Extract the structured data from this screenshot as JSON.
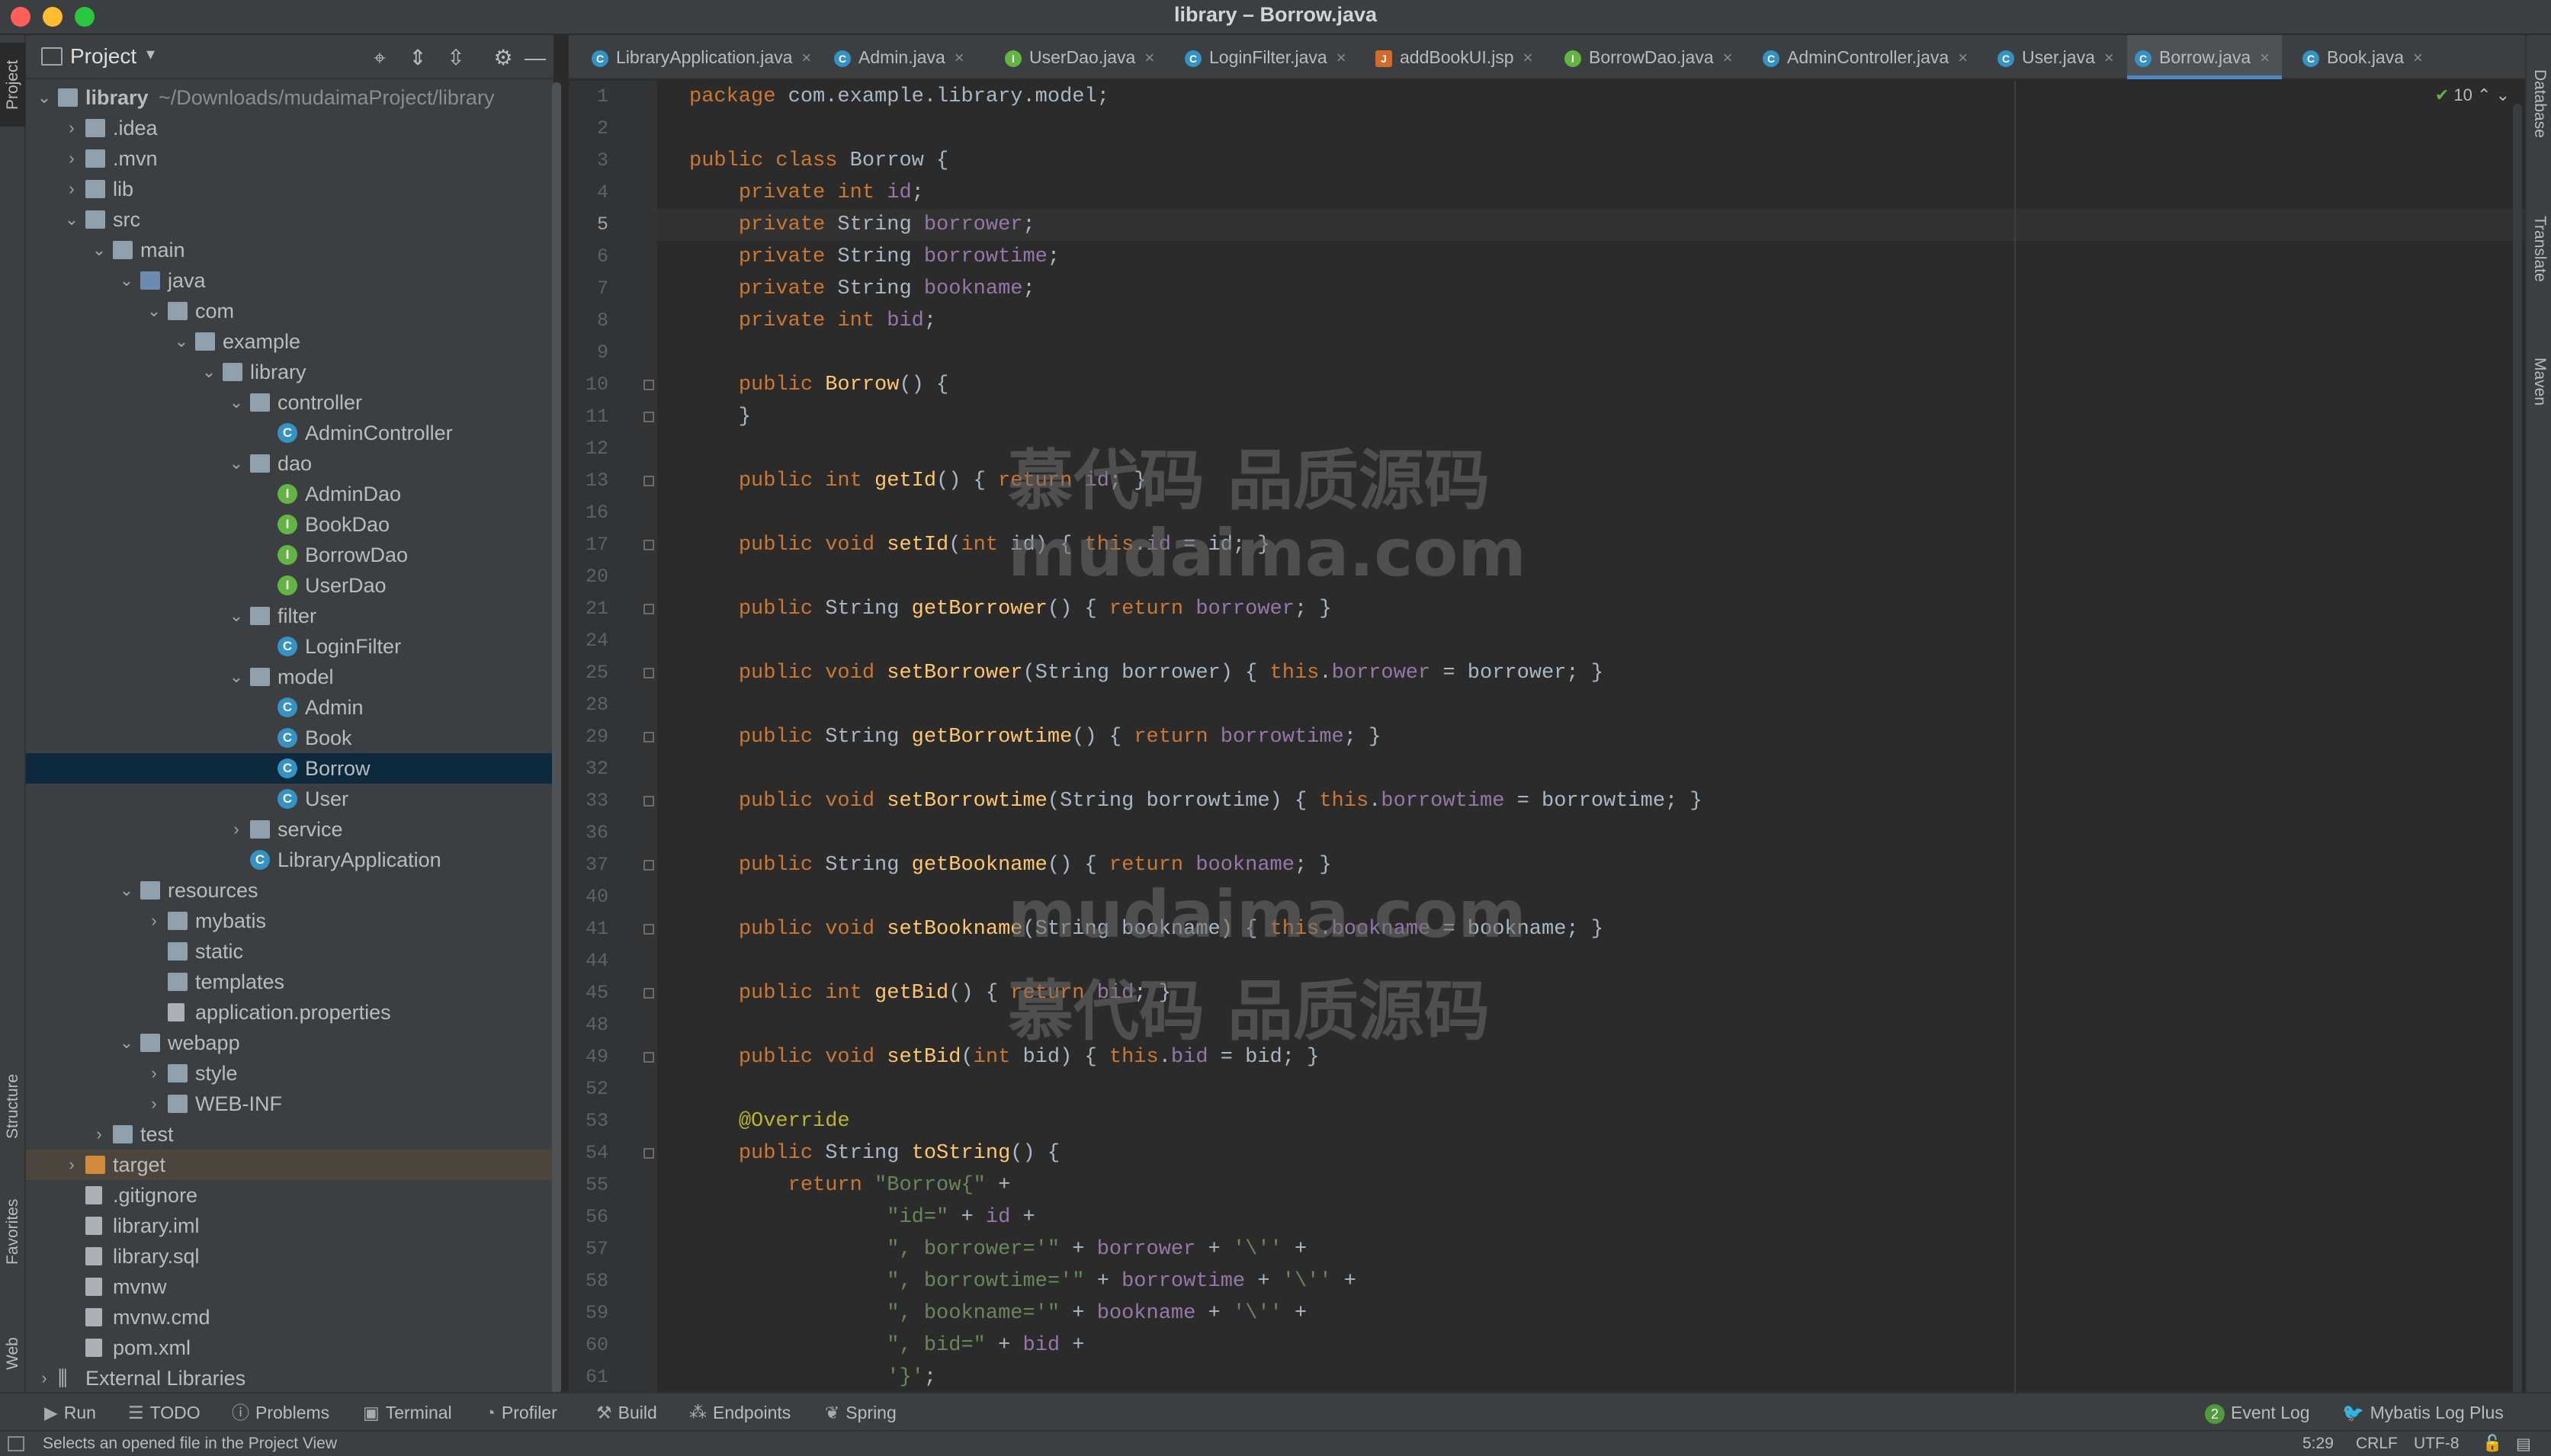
{
  "window": {
    "title": "library – Borrow.java"
  },
  "left_strip": {
    "project": "Project",
    "structure": "Structure",
    "favorites": "Favorites",
    "web": "Web"
  },
  "right_strip": {
    "database": "Database",
    "translate": "Translate",
    "maven": "Maven"
  },
  "project_panel": {
    "title": "Project"
  },
  "tree": [
    {
      "label": "library",
      "sub": "~/Downloads/mudaimaProject/library",
      "depth": 0,
      "arrow": "down",
      "icon": "folder",
      "bold": true
    },
    {
      "label": ".idea",
      "depth": 1,
      "arrow": "right",
      "icon": "folder"
    },
    {
      "label": ".mvn",
      "depth": 1,
      "arrow": "right",
      "icon": "folder"
    },
    {
      "label": "lib",
      "depth": 1,
      "arrow": "right",
      "icon": "folder"
    },
    {
      "label": "src",
      "depth": 1,
      "arrow": "down",
      "icon": "folder"
    },
    {
      "label": "main",
      "depth": 2,
      "arrow": "down",
      "icon": "folder"
    },
    {
      "label": "java",
      "depth": 3,
      "arrow": "down",
      "icon": "src"
    },
    {
      "label": "com",
      "depth": 4,
      "arrow": "down",
      "icon": "folder"
    },
    {
      "label": "example",
      "depth": 5,
      "arrow": "down",
      "icon": "folder"
    },
    {
      "label": "library",
      "depth": 6,
      "arrow": "down",
      "icon": "folder"
    },
    {
      "label": "controller",
      "depth": 7,
      "arrow": "down",
      "icon": "folder"
    },
    {
      "label": "AdminController",
      "depth": 8,
      "arrow": "",
      "icon": "class"
    },
    {
      "label": "dao",
      "depth": 7,
      "arrow": "down",
      "icon": "folder"
    },
    {
      "label": "AdminDao",
      "depth": 8,
      "arrow": "",
      "icon": "interface"
    },
    {
      "label": "BookDao",
      "depth": 8,
      "arrow": "",
      "icon": "interface"
    },
    {
      "label": "BorrowDao",
      "depth": 8,
      "arrow": "",
      "icon": "interface"
    },
    {
      "label": "UserDao",
      "depth": 8,
      "arrow": "",
      "icon": "interface"
    },
    {
      "label": "filter",
      "depth": 7,
      "arrow": "down",
      "icon": "folder"
    },
    {
      "label": "LoginFilter",
      "depth": 8,
      "arrow": "",
      "icon": "class"
    },
    {
      "label": "model",
      "depth": 7,
      "arrow": "down",
      "icon": "folder"
    },
    {
      "label": "Admin",
      "depth": 8,
      "arrow": "",
      "icon": "class"
    },
    {
      "label": "Book",
      "depth": 8,
      "arrow": "",
      "icon": "class"
    },
    {
      "label": "Borrow",
      "depth": 8,
      "arrow": "",
      "icon": "class",
      "selected": true
    },
    {
      "label": "User",
      "depth": 8,
      "arrow": "",
      "icon": "class"
    },
    {
      "label": "service",
      "depth": 7,
      "arrow": "right",
      "icon": "folder"
    },
    {
      "label": "LibraryApplication",
      "depth": 7,
      "arrow": "",
      "icon": "class"
    },
    {
      "label": "resources",
      "depth": 3,
      "arrow": "down",
      "icon": "folder"
    },
    {
      "label": "mybatis",
      "depth": 4,
      "arrow": "right",
      "icon": "folder"
    },
    {
      "label": "static",
      "depth": 4,
      "arrow": "",
      "icon": "folder"
    },
    {
      "label": "templates",
      "depth": 4,
      "arrow": "",
      "icon": "folder"
    },
    {
      "label": "application.properties",
      "depth": 4,
      "arrow": "",
      "icon": "file"
    },
    {
      "label": "webapp",
      "depth": 3,
      "arrow": "down",
      "icon": "folder"
    },
    {
      "label": "style",
      "depth": 4,
      "arrow": "right",
      "icon": "folder"
    },
    {
      "label": "WEB-INF",
      "depth": 4,
      "arrow": "right",
      "icon": "folder"
    },
    {
      "label": "test",
      "depth": 2,
      "arrow": "right",
      "icon": "folder"
    },
    {
      "label": "target",
      "depth": 1,
      "arrow": "right",
      "icon": "folder-orange",
      "target": true
    },
    {
      "label": ".gitignore",
      "depth": 1,
      "arrow": "",
      "icon": "file"
    },
    {
      "label": "library.iml",
      "depth": 1,
      "arrow": "",
      "icon": "file"
    },
    {
      "label": "library.sql",
      "depth": 1,
      "arrow": "",
      "icon": "file"
    },
    {
      "label": "mvnw",
      "depth": 1,
      "arrow": "",
      "icon": "file"
    },
    {
      "label": "mvnw.cmd",
      "depth": 1,
      "arrow": "",
      "icon": "file"
    },
    {
      "label": "pom.xml",
      "depth": 1,
      "arrow": "",
      "icon": "file"
    },
    {
      "label": "External Libraries",
      "depth": 0,
      "arrow": "right",
      "icon": "lib"
    }
  ],
  "tabs": [
    {
      "label": "LibraryApplication.java",
      "kind": "c"
    },
    {
      "label": "Admin.java",
      "kind": "c"
    },
    {
      "label": "UserDao.java",
      "kind": "i"
    },
    {
      "label": "LoginFilter.java",
      "kind": "c"
    },
    {
      "label": "addBookUI.jsp",
      "kind": "j"
    },
    {
      "label": "BorrowDao.java",
      "kind": "i"
    },
    {
      "label": "AdminController.java",
      "kind": "c"
    },
    {
      "label": "User.java",
      "kind": "c"
    },
    {
      "label": "Borrow.java",
      "kind": "c",
      "active": true
    },
    {
      "label": "Book.java",
      "kind": "c"
    }
  ],
  "editor": {
    "inspection_count": "10",
    "current_line": "5",
    "lines": [
      {
        "n": "1",
        "code": "package com.example.library.model;"
      },
      {
        "n": "2",
        "code": ""
      },
      {
        "n": "3",
        "code": "public class Borrow {"
      },
      {
        "n": "4",
        "code": "    private int id;"
      },
      {
        "n": "5",
        "code": "    private String borrower;"
      },
      {
        "n": "6",
        "code": "    private String borrowtime;"
      },
      {
        "n": "7",
        "code": "    private String bookname;"
      },
      {
        "n": "8",
        "code": "    private int bid;"
      },
      {
        "n": "9",
        "code": ""
      },
      {
        "n": "10",
        "code": "    public Borrow() {"
      },
      {
        "n": "11",
        "code": "    }"
      },
      {
        "n": "12",
        "code": ""
      },
      {
        "n": "13",
        "code": "    public int getId() { return id; }"
      },
      {
        "n": "16",
        "code": ""
      },
      {
        "n": "17",
        "code": "    public void setId(int id) { this.id = id; }"
      },
      {
        "n": "20",
        "code": ""
      },
      {
        "n": "21",
        "code": "    public String getBorrower() { return borrower; }"
      },
      {
        "n": "24",
        "code": ""
      },
      {
        "n": "25",
        "code": "    public void setBorrower(String borrower) { this.borrower = borrower; }"
      },
      {
        "n": "28",
        "code": ""
      },
      {
        "n": "29",
        "code": "    public String getBorrowtime() { return borrowtime; }"
      },
      {
        "n": "32",
        "code": ""
      },
      {
        "n": "33",
        "code": "    public void setBorrowtime(String borrowtime) { this.borrowtime = borrowtime; }"
      },
      {
        "n": "36",
        "code": ""
      },
      {
        "n": "37",
        "code": "    public String getBookname() { return bookname; }"
      },
      {
        "n": "40",
        "code": ""
      },
      {
        "n": "41",
        "code": "    public void setBookname(String bookname) { this.bookname = bookname; }"
      },
      {
        "n": "44",
        "code": ""
      },
      {
        "n": "45",
        "code": "    public int getBid() { return bid; }"
      },
      {
        "n": "48",
        "code": ""
      },
      {
        "n": "49",
        "code": "    public void setBid(int bid) { this.bid = bid; }"
      },
      {
        "n": "52",
        "code": ""
      },
      {
        "n": "53",
        "code": "    @Override"
      },
      {
        "n": "54",
        "code": "    public String toString() {"
      },
      {
        "n": "55",
        "code": "        return \"Borrow{\" +"
      },
      {
        "n": "56",
        "code": "                \"id=\" + id +"
      },
      {
        "n": "57",
        "code": "                \", borrower='\" + borrower + '\\'' +"
      },
      {
        "n": "58",
        "code": "                \", borrowtime='\" + borrowtime + '\\'' +"
      },
      {
        "n": "59",
        "code": "                \", bookname='\" + bookname + '\\'' +"
      },
      {
        "n": "60",
        "code": "                \", bid=\" + bid +"
      },
      {
        "n": "61",
        "code": "                '}';"
      }
    ]
  },
  "watermark": {
    "line1": "慕代码 品质源码",
    "line2": "mudaima.com",
    "line3": "mudaima.com",
    "line4": "慕代码 品质源码"
  },
  "bottom_tools": {
    "run": "Run",
    "todo": "TODO",
    "problems": "Problems",
    "terminal": "Terminal",
    "profiler": "Profiler",
    "build": "Build",
    "endpoints": "Endpoints",
    "spring": "Spring",
    "event_log": "Event Log",
    "event_count": "2",
    "mybatis": "Mybatis Log Plus"
  },
  "status": {
    "message": "Selects an opened file in the Project View",
    "position": "5:29",
    "line_sep": "CRLF",
    "encoding": "UTF-8"
  }
}
